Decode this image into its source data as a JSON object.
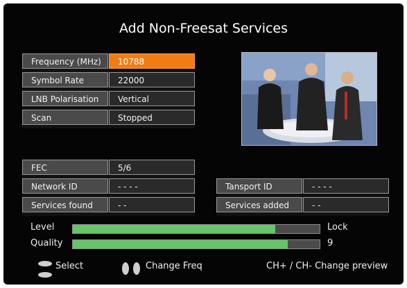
{
  "title": "Add Non-Freesat Services",
  "tuning": [
    {
      "label": "Frequency (MHz)",
      "value": "10788",
      "selected": true
    },
    {
      "label": "Symbol Rate",
      "value": "22000"
    },
    {
      "label": "LNB Polarisation",
      "value": "Vertical"
    },
    {
      "label": "Scan",
      "value": "Stopped"
    }
  ],
  "info_left": [
    {
      "label": "FEC",
      "value": "5/6"
    },
    {
      "label": "Network ID",
      "value": "- - - -"
    },
    {
      "label": "Services found",
      "value": "- -"
    }
  ],
  "info_right": [
    {
      "label": "Tansport ID",
      "value": "- - - -"
    },
    {
      "label": "Services added",
      "value": "- -"
    }
  ],
  "signal": {
    "level_label": "Level",
    "level_fraction": 0.82,
    "level_status": "Lock",
    "quality_label": "Quality",
    "quality_fraction": 0.87,
    "quality_value": "9"
  },
  "hints": {
    "select": "Select",
    "change_freq": "Change Freq",
    "preview": "CH+ / CH- Change preview"
  },
  "colors": {
    "selected": "#f07d14",
    "bar_fill": "#68c469"
  }
}
